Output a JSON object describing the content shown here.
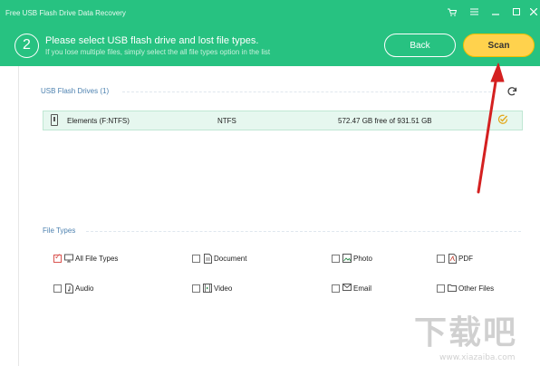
{
  "window": {
    "title": "Free USB Flash Drive Data Recovery",
    "controls": [
      "cart-icon",
      "menu-icon",
      "minimize-icon",
      "maximize-icon",
      "close-icon"
    ]
  },
  "step": {
    "number": "2",
    "title": "Please select USB flash drive and lost file types.",
    "subtitle": "If you lose multiple files, simply select the all file types option in the list"
  },
  "buttons": {
    "back": "Back",
    "scan": "Scan"
  },
  "usb_section": {
    "title": "USB Flash Drives (1)",
    "drives": [
      {
        "name": "Elements (F:NTFS)",
        "filesystem": "NTFS",
        "space": "572.47 GB free of 931.51 GB",
        "selected": true
      }
    ]
  },
  "file_types": {
    "title": "File Types",
    "items": [
      {
        "label": "All File Types",
        "checked": true,
        "icon": "monitor-icon"
      },
      {
        "label": "Document",
        "checked": false,
        "icon": "document-icon"
      },
      {
        "label": "Photo",
        "checked": false,
        "icon": "photo-icon"
      },
      {
        "label": "PDF",
        "checked": false,
        "icon": "pdf-icon"
      },
      {
        "label": "Audio",
        "checked": false,
        "icon": "audio-icon"
      },
      {
        "label": "Video",
        "checked": false,
        "icon": "video-icon"
      },
      {
        "label": "Email",
        "checked": false,
        "icon": "email-icon"
      },
      {
        "label": "Other Files",
        "checked": false,
        "icon": "folder-icon"
      }
    ]
  },
  "watermark": {
    "text": "下载吧",
    "url": "www.xiazaiba.com"
  },
  "colors": {
    "header": "#27c281",
    "scan_button": "#ffd24d",
    "arrow": "#d42020",
    "section_label": "#4d82b0"
  }
}
